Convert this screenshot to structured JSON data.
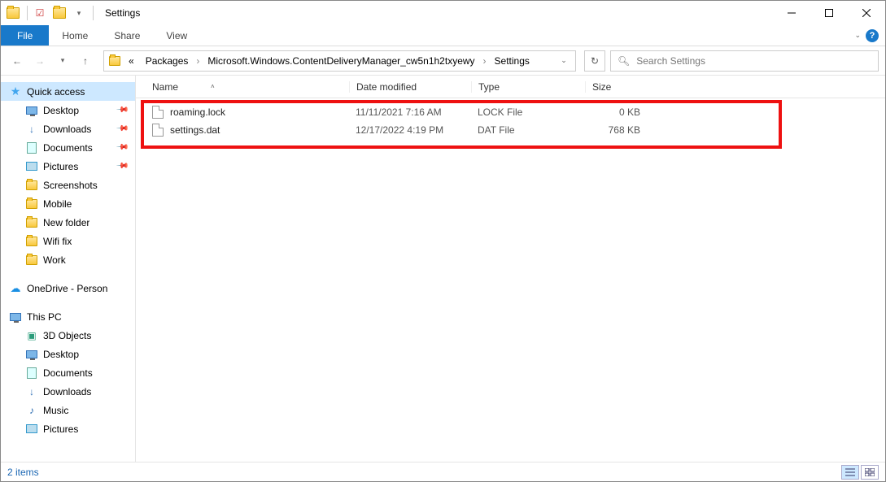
{
  "title": "Settings",
  "ribbon": {
    "file": "File",
    "tabs": [
      "Home",
      "Share",
      "View"
    ]
  },
  "breadcrumbs": {
    "overflow": "«",
    "items": [
      "Packages",
      "Microsoft.Windows.ContentDeliveryManager_cw5n1h2txyewy",
      "Settings"
    ]
  },
  "search": {
    "placeholder": "Search Settings"
  },
  "columns": {
    "name": "Name",
    "date": "Date modified",
    "type": "Type",
    "size": "Size"
  },
  "files": [
    {
      "name": "roaming.lock",
      "date": "11/11/2021 7:16 AM",
      "type": "LOCK File",
      "size": "0 KB"
    },
    {
      "name": "settings.dat",
      "date": "12/17/2022 4:19 PM",
      "type": "DAT File",
      "size": "768 KB"
    }
  ],
  "sidebar": {
    "quick_access": "Quick access",
    "quick_items": [
      {
        "label": "Desktop",
        "icon": "desktop",
        "pinned": true
      },
      {
        "label": "Downloads",
        "icon": "downloads",
        "pinned": true
      },
      {
        "label": "Documents",
        "icon": "documents",
        "pinned": true
      },
      {
        "label": "Pictures",
        "icon": "pictures",
        "pinned": true
      },
      {
        "label": "Screenshots",
        "icon": "folder",
        "pinned": false
      },
      {
        "label": "Mobile",
        "icon": "folder",
        "pinned": false
      },
      {
        "label": "New folder",
        "icon": "folder",
        "pinned": false
      },
      {
        "label": "Wifi fix",
        "icon": "folder",
        "pinned": false
      },
      {
        "label": "Work",
        "icon": "folder",
        "pinned": false
      }
    ],
    "onedrive": "OneDrive - Person",
    "this_pc": "This PC",
    "pc_items": [
      {
        "label": "3D Objects",
        "icon": "3d"
      },
      {
        "label": "Desktop",
        "icon": "desktop"
      },
      {
        "label": "Documents",
        "icon": "documents"
      },
      {
        "label": "Downloads",
        "icon": "downloads"
      },
      {
        "label": "Music",
        "icon": "music"
      },
      {
        "label": "Pictures",
        "icon": "pictures"
      }
    ]
  },
  "status": {
    "item_count": "2 items"
  }
}
